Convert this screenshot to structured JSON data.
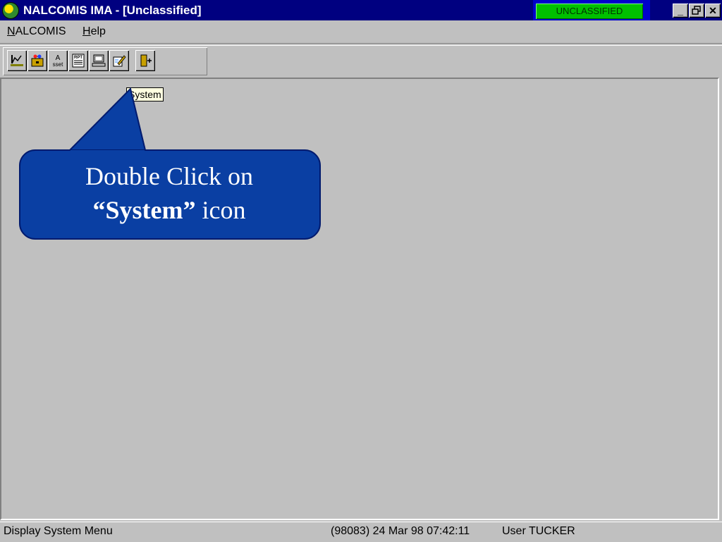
{
  "window": {
    "title": "NALCOMIS IMA - [Unclassified]",
    "classification_badge": "UNCLASSIFIED",
    "minimize_glyph": "_",
    "restore_glyph": "❐",
    "close_glyph": "✕",
    "colors": {
      "titlebar": "#000080",
      "badge": "#00c000",
      "callout": "#0a3fa3"
    }
  },
  "menu": {
    "items": [
      {
        "label_u": "N",
        "label_rest": "ALCOMIS"
      },
      {
        "label_u": "H",
        "label_rest": "elp"
      }
    ]
  },
  "toolbar": {
    "buttons": [
      {
        "icon": "chart-icon"
      },
      {
        "icon": "briefcase-icon"
      },
      {
        "icon": "asset-icon",
        "text_top": "A",
        "text_bottom": "sset"
      },
      {
        "icon": "report-icon",
        "text": "RPT"
      },
      {
        "icon": "system-computer-icon"
      },
      {
        "icon": "edit-pencil-icon"
      },
      {
        "icon": "exit-door-icon"
      }
    ]
  },
  "tooltip": {
    "text": "System"
  },
  "callout": {
    "line1": "Double Click on",
    "line2_bold": "“System”",
    "line2_rest": " icon"
  },
  "statusbar": {
    "message": "Display System Menu",
    "session": "(98083)  24 Mar 98  07:42:11",
    "user": "User TUCKER"
  }
}
